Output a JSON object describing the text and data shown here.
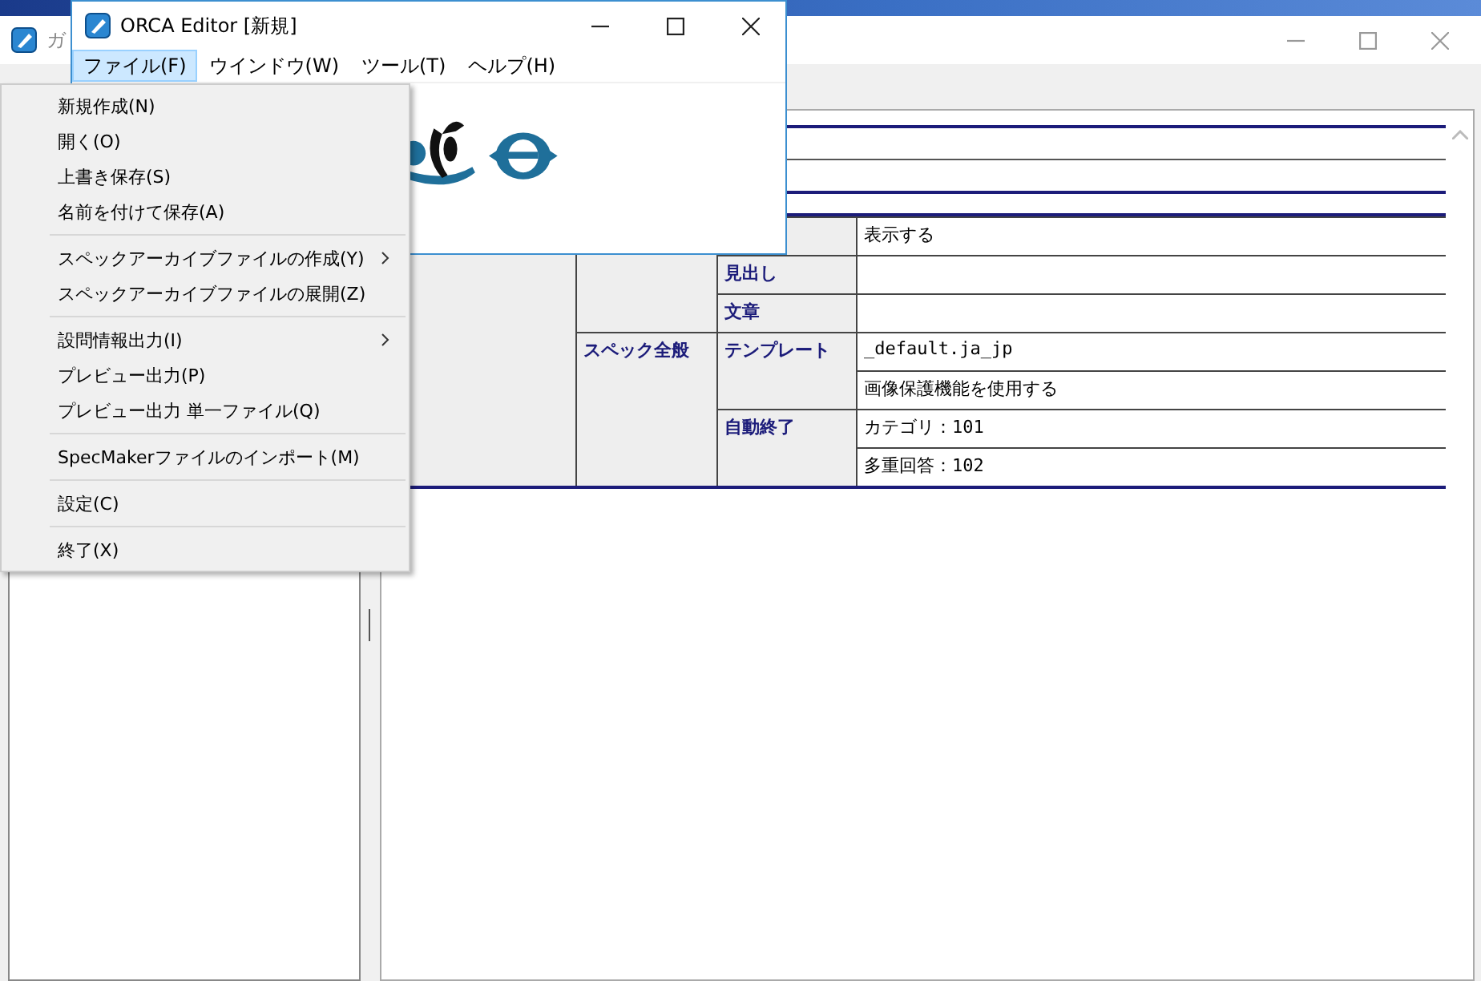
{
  "back_window": {
    "title": "ガ",
    "sections": [
      {
        "groups": [
          {
            "values": [
              "表示する"
            ]
          },
          {
            "label": "見出し"
          },
          {
            "label": "文章"
          }
        ]
      },
      {
        "heading": "スペック全般",
        "groups": [
          {
            "label": "テンプレート",
            "values": [
              "_default.ja_jp",
              "画像保護機能を使用する"
            ]
          },
          {
            "label": "自動終了",
            "values": [
              "カテゴリ：101",
              "多重回答：102"
            ]
          }
        ]
      }
    ]
  },
  "front_window": {
    "title": "ORCA Editor [新規]",
    "menu": [
      {
        "label": "ファイル(F)",
        "selected": true
      },
      {
        "label": "ウインドウ(W)",
        "selected": false
      },
      {
        "label": "ツール(T)",
        "selected": false
      },
      {
        "label": "ヘルプ(H)",
        "selected": false
      }
    ]
  },
  "file_menu": {
    "items": [
      {
        "kind": "item",
        "label": "新規作成(N)",
        "submenu": false
      },
      {
        "kind": "item",
        "label": "開く(O)",
        "submenu": false
      },
      {
        "kind": "item",
        "label": "上書き保存(S)",
        "submenu": false
      },
      {
        "kind": "item",
        "label": "名前を付けて保存(A)",
        "submenu": false
      },
      {
        "kind": "separator"
      },
      {
        "kind": "item",
        "label": "スペックアーカイブファイルの作成(Y)",
        "submenu": true
      },
      {
        "kind": "item",
        "label": "スペックアーカイブファイルの展開(Z)",
        "submenu": false
      },
      {
        "kind": "separator"
      },
      {
        "kind": "item",
        "label": "設問情報出力(I)",
        "submenu": true
      },
      {
        "kind": "item",
        "label": "プレビュー出力(P)",
        "submenu": false
      },
      {
        "kind": "item",
        "label": "プレビュー出力 単一ファイル(Q)",
        "submenu": false
      },
      {
        "kind": "separator"
      },
      {
        "kind": "item",
        "label": "SpecMakerファイルのインポート(M)",
        "submenu": false
      },
      {
        "kind": "separator"
      },
      {
        "kind": "item",
        "label": "設定(C)",
        "submenu": false
      },
      {
        "kind": "separator"
      },
      {
        "kind": "item",
        "label": "終了(X)",
        "submenu": false
      }
    ]
  }
}
